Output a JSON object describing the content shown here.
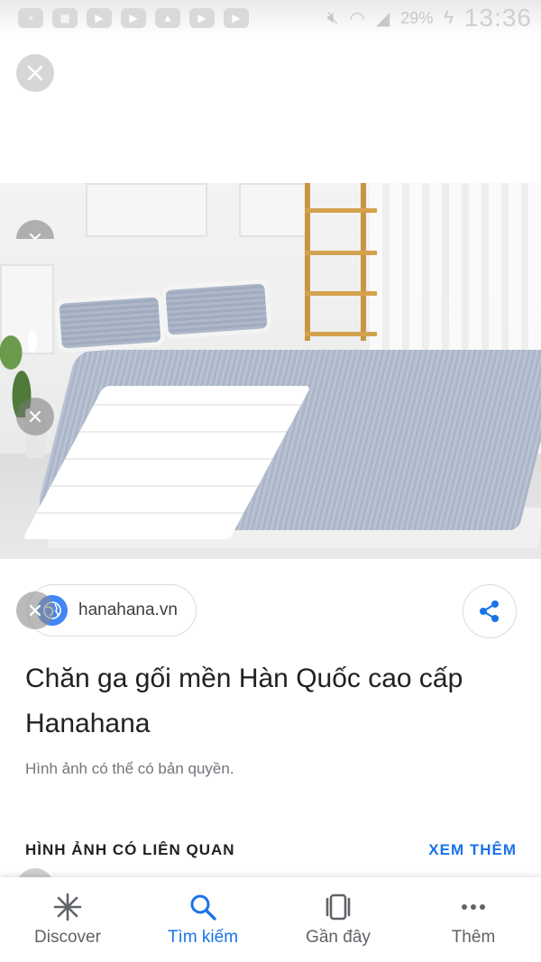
{
  "status_bar": {
    "battery": "29%",
    "time": "13:36"
  },
  "source": {
    "domain": "hanahana.vn"
  },
  "result": {
    "title": "Chăn ga gối mền Hàn Quốc cao cấp Hanahana",
    "copyright_note": "Hình ảnh có thể có bản quyền."
  },
  "related": {
    "label": "HÌNH ẢNH CÓ LIÊN QUAN",
    "see_more": "XEM THÊM"
  },
  "bottom_nav": {
    "discover": "Discover",
    "search": "Tìm kiếm",
    "recent": "Gần đây",
    "more": "Thêm"
  },
  "colors": {
    "accent": "#1a73e8",
    "text": "#202124",
    "muted": "#70757a"
  }
}
